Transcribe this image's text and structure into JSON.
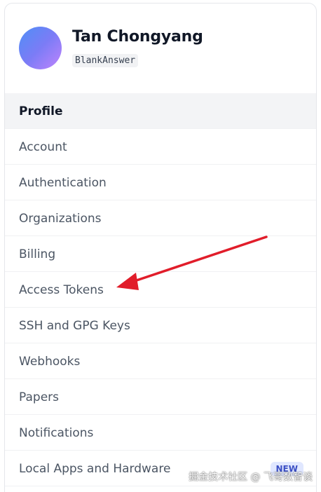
{
  "user": {
    "name": "Tan Chongyang",
    "handle": "BlankAnswer",
    "avatar_gradient": [
      "#4f8ff7",
      "#c084fc"
    ]
  },
  "nav": {
    "items": [
      {
        "label": "Profile",
        "active": true
      },
      {
        "label": "Account"
      },
      {
        "label": "Authentication"
      },
      {
        "label": "Organizations"
      },
      {
        "label": "Billing"
      },
      {
        "label": "Access Tokens"
      },
      {
        "label": "SSH and GPG Keys"
      },
      {
        "label": "Webhooks"
      },
      {
        "label": "Papers"
      },
      {
        "label": "Notifications"
      },
      {
        "label": "Local Apps and Hardware",
        "badge": "NEW"
      }
    ]
  },
  "annotation": {
    "color": "#e11d2a",
    "target": "Access Tokens"
  },
  "watermark": "掘金技术社区 @ 飞哥数智谈"
}
